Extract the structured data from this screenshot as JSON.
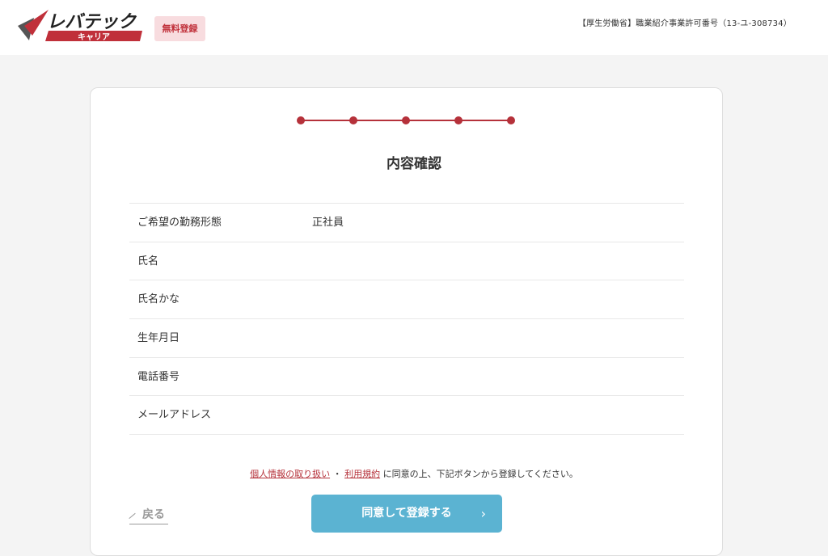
{
  "header": {
    "logo_main": "レバテック",
    "logo_sub": "キャリア",
    "badge": "無料登録",
    "license": "【厚生労働省】職業紹介事業許可番号（13-ユ-308734）"
  },
  "colors": {
    "accent": "#b5313a",
    "button": "#5bb3d2",
    "badge_bg": "#f8dcdf"
  },
  "progress": {
    "current_step": 5,
    "total_steps": 5
  },
  "page": {
    "title": "内容確認"
  },
  "rows": [
    {
      "label": "ご希望の勤務形態",
      "value": "正社員"
    },
    {
      "label": "氏名",
      "value": ""
    },
    {
      "label": "氏名かな",
      "value": ""
    },
    {
      "label": "生年月日",
      "value": ""
    },
    {
      "label": "電話番号",
      "value": ""
    },
    {
      "label": "メールアドレス",
      "value": ""
    }
  ],
  "consent": {
    "privacy_link": "個人情報の取り扱い",
    "separator": "・",
    "terms_link": "利用規約",
    "text": "に同意の上、下記ボタンから登録してください。"
  },
  "actions": {
    "back_label": "戻る",
    "submit_label": "同意して登録する",
    "submit_icon": "chevron-right-icon"
  }
}
